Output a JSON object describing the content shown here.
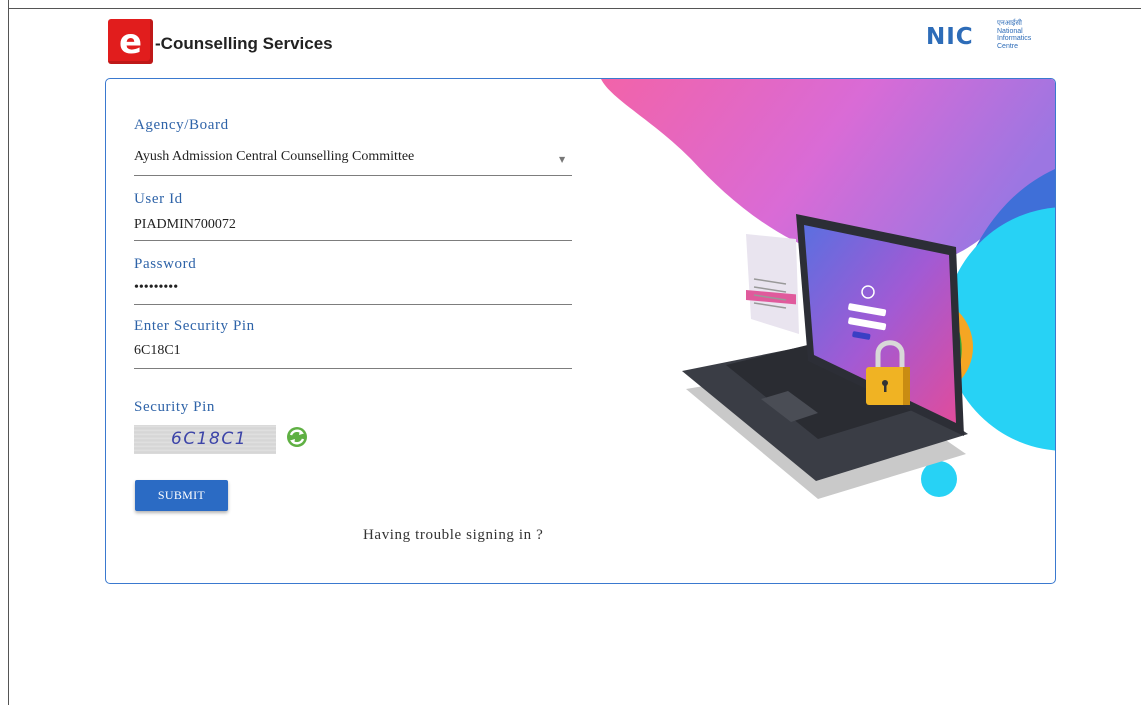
{
  "header": {
    "logo_letter": "e",
    "brand_title": "-Counselling Services",
    "nic_letters": "NIC",
    "nic_hindi": "एनआईसी",
    "nic_lines": [
      "National",
      "Informatics",
      "Centre"
    ]
  },
  "form": {
    "agency": {
      "label": "Agency/Board",
      "value": "Ayush Admission Central Counselling Committee",
      "arrow": "▼"
    },
    "user_id": {
      "label": "User Id",
      "value": "PIADMIN700072"
    },
    "password": {
      "label": "Password",
      "value": "•••••••••"
    },
    "security_pin_input": {
      "label": "Enter Security Pin",
      "value": "6C18C1"
    },
    "security_pin": {
      "label": "Security Pin",
      "captcha_text": "6C18C1"
    },
    "submit_label": "SUBMIT",
    "trouble_link": "Having trouble signing in ?"
  },
  "colors": {
    "accent": "#2b6bc4",
    "label": "#2e63a8",
    "logo_red": "#e11d1d"
  }
}
